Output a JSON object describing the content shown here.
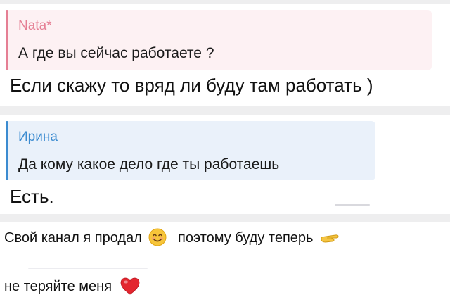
{
  "message1": {
    "quote": {
      "author": "Nata*",
      "text": "А где вы сейчас работаете ?",
      "accent": "#e57f94",
      "bg": "#fdf1f3"
    },
    "reply": "Если скажу то вряд ли буду там работать )"
  },
  "message2": {
    "quote": {
      "author": "Ирина",
      "text": "Да кому какое дело где ты работаешь",
      "accent": "#3b8bd0",
      "bg": "#eaf1fa"
    },
    "reply": "Есть."
  },
  "post": {
    "line1_part1": "Свой канал я продал",
    "emoji1": "smiling-face-icon",
    "line1_part2": "поэтому буду теперь",
    "emoji2": "pointing-hand-icon",
    "line2": "не теряйте меня",
    "emoji3": "red-heart-icon"
  }
}
